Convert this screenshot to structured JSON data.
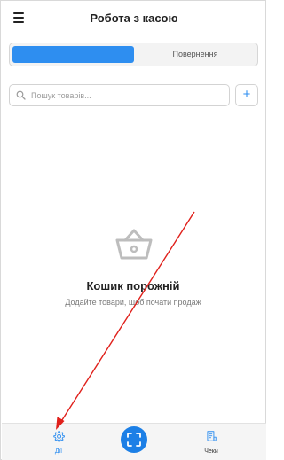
{
  "header": {
    "title": "Робота з касою",
    "menu_icon": "hamburger-menu-icon"
  },
  "segments": {
    "active_color": "#2e8ef0",
    "second_label": "Повернення"
  },
  "search": {
    "placeholder": "Пошук товарів...",
    "icon": "search-icon",
    "add_label": "+"
  },
  "empty_state": {
    "icon": "basket-icon",
    "title": "Кошик порожній",
    "subtitle": "Додайте товари, щоб почати продаж"
  },
  "bottom_nav": {
    "actions_label": "Дії",
    "actions_icon": "gear-icon",
    "scan_icon": "scan-icon",
    "receipts_label": "Чеки",
    "receipts_icon": "receipt-icon",
    "accent": "#1c7fe6"
  },
  "annotation": {
    "arrow_color": "#e0201b"
  }
}
